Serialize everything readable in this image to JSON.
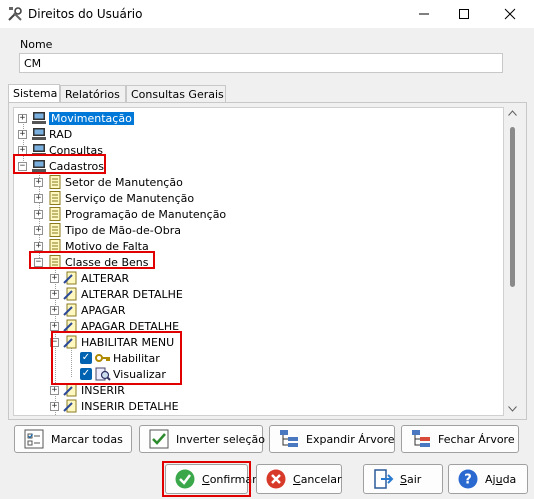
{
  "window": {
    "title": "Direitos do Usuário"
  },
  "form": {
    "name_label": "Nome",
    "name_value": "CM"
  },
  "tabs": [
    {
      "label": "Sistema",
      "active": true
    },
    {
      "label": "Relatórios",
      "active": false
    },
    {
      "label": "Consultas Gerais",
      "active": false
    }
  ],
  "tree": {
    "movimentacao": "Movimentação",
    "rad": "RAD",
    "consultas": "Consultas",
    "cadastros": "Cadastros",
    "setor": "Setor de Manutenção",
    "servico": "Serviço de Manutenção",
    "programacao": "Programação de Manutenção",
    "tipo": "Tipo de Mão-de-Obra",
    "motivo": "Motivo de Falta",
    "classe": "Classe de Bens",
    "alterar": "ALTERAR",
    "alterar_detalhe": "ALTERAR DETALHE",
    "apagar": "APAGAR",
    "apagar_detalhe": "APAGAR DETALHE",
    "habilitar_menu": "HABILITAR MENU",
    "habilitar": "Habilitar",
    "visualizar": "Visualizar",
    "inserir": "INSERIR",
    "inserir_detalhe": "INSERIR DETALHE"
  },
  "toolbar": {
    "marcar_todas": "Marcar todas",
    "inverter": "Inverter seleção",
    "expandir": "Expandir Árvore",
    "fechar": "Fechar Árvore"
  },
  "actions": {
    "confirmar_u": "C",
    "confirmar_rest": "onfirmar",
    "cancelar_u": "C",
    "cancelar_rest": "ancelar",
    "sair_u": "S",
    "sair_rest": "air",
    "ajuda_pre": "Aj",
    "ajuda_u": "u",
    "ajuda_post": "da"
  },
  "colors": {
    "accent": "#0078d7",
    "highlight": "#e00000",
    "check": "#0063b1"
  }
}
